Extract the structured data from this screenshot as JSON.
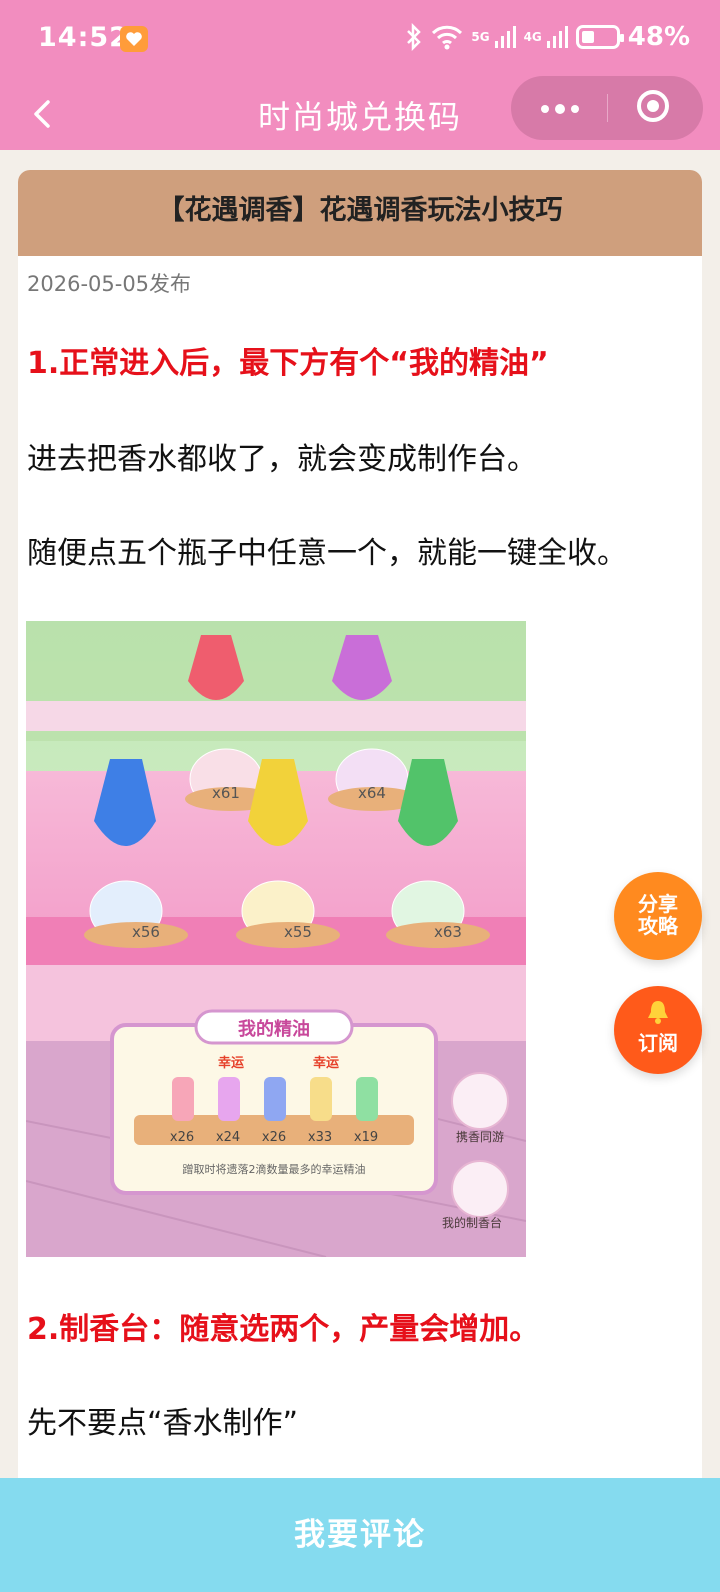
{
  "status_bar": {
    "time": "14:52",
    "battery": "48%",
    "signal_1": "5G",
    "signal_2": "4G"
  },
  "nav": {
    "title": "时尚城兑换码"
  },
  "article": {
    "header": "【花遇调香】花遇调香玩法小技巧",
    "date": "2026-05-05发布",
    "paragraphs": [
      "1.正常进入后，最下方有个“我的精油”",
      "进去把香水都收了，就会变成制作台。",
      "随便点五个瓶子中任意一个，就能一键全收。",
      "2.制香台：随意选两个，产量会增加。",
      "先不要点“香水制作”"
    ],
    "image": {
      "counts_top": [
        "x61",
        "x64"
      ],
      "counts_bottom": [
        "x56",
        "x55",
        "x63"
      ],
      "panel_title": "我的精油",
      "lucky_tag": "幸运",
      "oil_counts": [
        "x26",
        "x24",
        "x26",
        "x33",
        "x19"
      ],
      "panel_note": "蹭取时将遗落2滴数量最多的幸运精油",
      "side_label_1": "携香同游",
      "side_label_2": "我的制香台"
    }
  },
  "floating": {
    "share_line1": "分享",
    "share_line2": "攻略",
    "subscribe": "订阅"
  },
  "bottom": {
    "comment": "我要评论"
  },
  "colors": {
    "header_pink": "#f28dbf",
    "card_header": "#cf9f7d",
    "highlight_red": "#e6101a",
    "comment_bar": "#85dbef",
    "share_orange": "#ff8a1f",
    "subscribe_orange": "#ff5a1a"
  }
}
